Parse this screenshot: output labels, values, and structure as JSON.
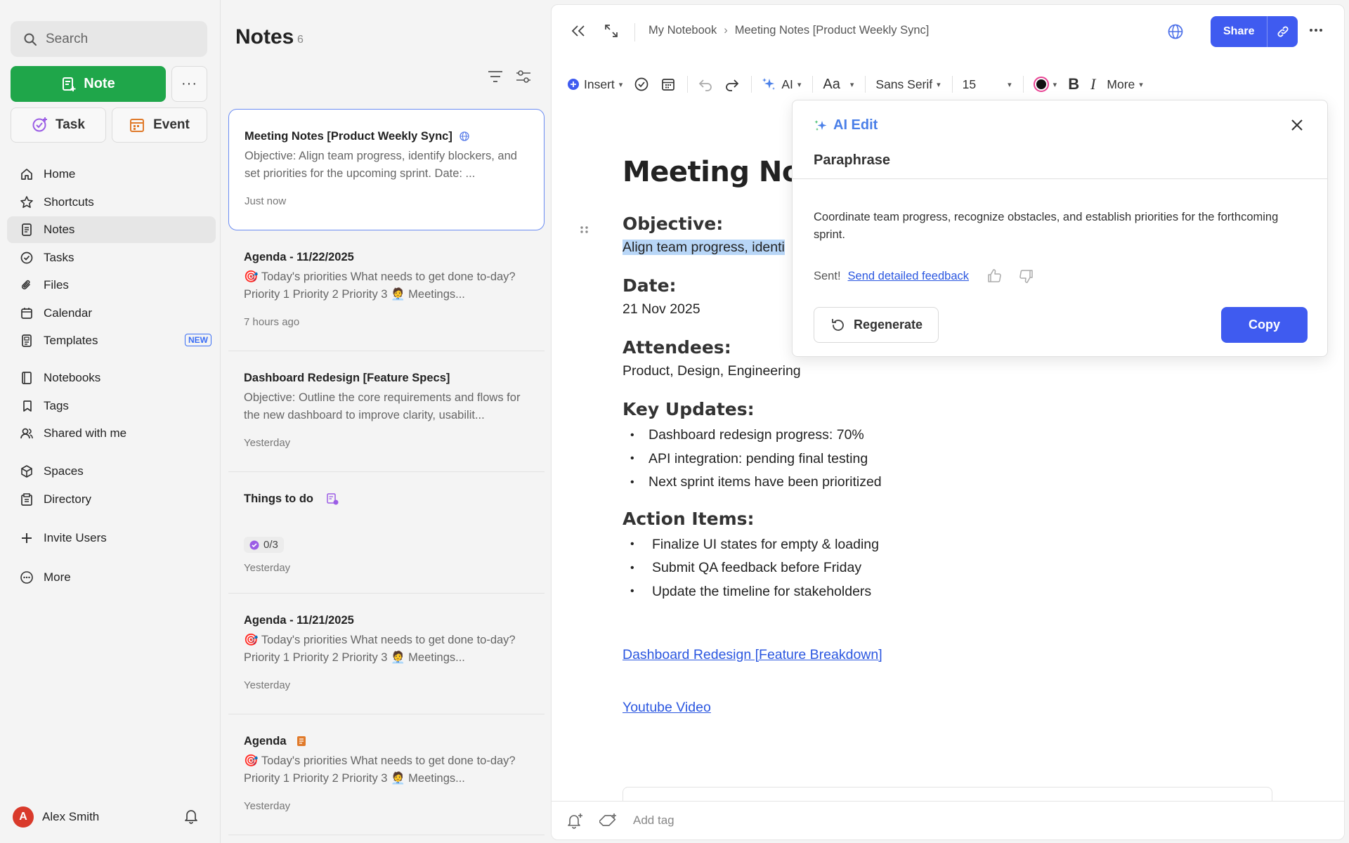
{
  "sidebar": {
    "search_placeholder": "Search",
    "note_button": "Note",
    "more_button": "···",
    "task_button": "Task",
    "event_button": "Event",
    "nav_primary": [
      {
        "label": "Home",
        "icon": "home-icon"
      },
      {
        "label": "Shortcuts",
        "icon": "star-icon"
      },
      {
        "label": "Notes",
        "icon": "notes-icon",
        "active": true
      },
      {
        "label": "Tasks",
        "icon": "check-circle-icon"
      },
      {
        "label": "Files",
        "icon": "paperclip-icon"
      },
      {
        "label": "Calendar",
        "icon": "calendar-icon"
      },
      {
        "label": "Templates",
        "icon": "template-icon",
        "badge": "NEW"
      }
    ],
    "nav_secondary": [
      {
        "label": "Notebooks",
        "icon": "notebook-icon"
      },
      {
        "label": "Tags",
        "icon": "tag-icon"
      },
      {
        "label": "Shared with me",
        "icon": "shared-icon"
      }
    ],
    "nav_tertiary": [
      {
        "label": "Spaces",
        "icon": "cube-icon"
      },
      {
        "label": "Directory",
        "icon": "directory-icon"
      }
    ],
    "invite_users": "Invite Users",
    "more": "More",
    "user": {
      "initial": "A",
      "name": "Alex Smith"
    }
  },
  "notes_list": {
    "title": "Notes",
    "count": "6",
    "items": [
      {
        "title": "Meeting Notes [Product Weekly Sync]",
        "preview": "Objective: Align team progress, identify blockers, and set priorities for the upcoming sprint. Date: ...",
        "time": "Just now"
      },
      {
        "title": "Agenda - 11/22/2025",
        "preview": "🎯 Today's priorities What needs to get done to-day? Priority 1 Priority 2 Priority 3 🧑‍💼 Meetings...",
        "time": "7 hours ago"
      },
      {
        "title": "Dashboard Redesign [Feature Specs]",
        "preview": "Objective: Outline the core requirements and flows for the new dashboard to improve clarity, usabilit...",
        "time": "Yesterday"
      },
      {
        "title": "Things to do",
        "check": "0/3",
        "time": "Yesterday"
      },
      {
        "title": "Agenda - 11/21/2025",
        "preview": "🎯 Today's priorities What needs to get done to-day? Priority 1 Priority 2 Priority 3 🧑‍💼 Meetings...",
        "time": "Yesterday"
      },
      {
        "title": "Agenda",
        "preview": "🎯 Today's priorities What needs to get done to-day? Priority 1 Priority 2 Priority 3 🧑‍💼 Meetings...",
        "time": "Yesterday"
      }
    ]
  },
  "editor": {
    "breadcrumb": [
      "My Notebook",
      "Meeting Notes [Product Weekly Sync]"
    ],
    "share_label": "Share",
    "toolbar": {
      "insert": "Insert",
      "ai": "AI",
      "text_style": "Aa",
      "font": "Sans Serif",
      "size": "15",
      "more": "More"
    },
    "doc": {
      "title": "Meeting Notes",
      "objective_heading": "Objective:",
      "objective_text": "Align team progress, identi",
      "date_heading": "Date:",
      "date_text": "21 Nov 2025",
      "attendees_heading": "Attendees:",
      "attendees_text": "Product, Design, Engineering",
      "updates_heading": "Key Updates:",
      "updates": [
        "Dashboard redesign progress: 70%",
        "API integration: pending final testing",
        "Next sprint items have been prioritized"
      ],
      "actions_heading": "Action Items:",
      "actions": [
        "Finalize UI states for empty & loading",
        "Submit QA feedback before Friday",
        "Update the timeline for stakeholders"
      ],
      "link1": "Dashboard Redesign [Feature Breakdown]",
      "link2": "Youtube Video"
    },
    "footer": {
      "add_tag_placeholder": "Add tag"
    }
  },
  "ai_panel": {
    "title": "AI Edit",
    "action": "Paraphrase",
    "result": "Coordinate team progress, recognize obstacles, and establish priorities for the forthcoming sprint.",
    "sent": "Sent!",
    "feedback_link": "Send detailed feedback",
    "regenerate": "Regenerate",
    "copy": "Copy"
  },
  "colors": {
    "primary_green": "#1fa64a",
    "primary_blue": "#3f5bf0",
    "link_blue": "#2b57e0",
    "ai_blue": "#4a7fe8",
    "highlight": "#b8d6f7",
    "avatar_red": "#d93a2b"
  }
}
